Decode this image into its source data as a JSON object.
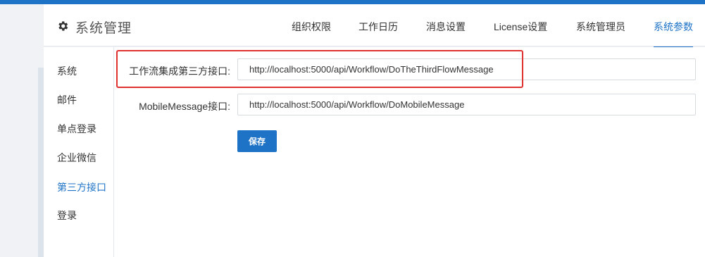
{
  "header": {
    "icon": "gear-icon",
    "title": "系统管理",
    "tabs": [
      {
        "label": "组织权限"
      },
      {
        "label": "工作日历"
      },
      {
        "label": "消息设置"
      },
      {
        "label": "License设置"
      },
      {
        "label": "系统管理员"
      },
      {
        "label": "系统参数",
        "active": true
      }
    ]
  },
  "sidebar": {
    "items": [
      {
        "label": "系统"
      },
      {
        "label": "邮件"
      },
      {
        "label": "单点登录"
      },
      {
        "label": "企业微信"
      },
      {
        "label": "第三方接口",
        "active": true
      },
      {
        "label": "登录"
      }
    ]
  },
  "form": {
    "fields": [
      {
        "label": "工作流集成第三方接口:",
        "value": "http://localhost:5000/api/Workflow/DoTheThirdFlowMessage"
      },
      {
        "label": "MobileMessage接口:",
        "value": "http://localhost:5000/api/Workflow/DoMobileMessage"
      }
    ],
    "save_label": "保存"
  },
  "colors": {
    "accent": "#1e73c6",
    "highlight": "#e03131"
  }
}
